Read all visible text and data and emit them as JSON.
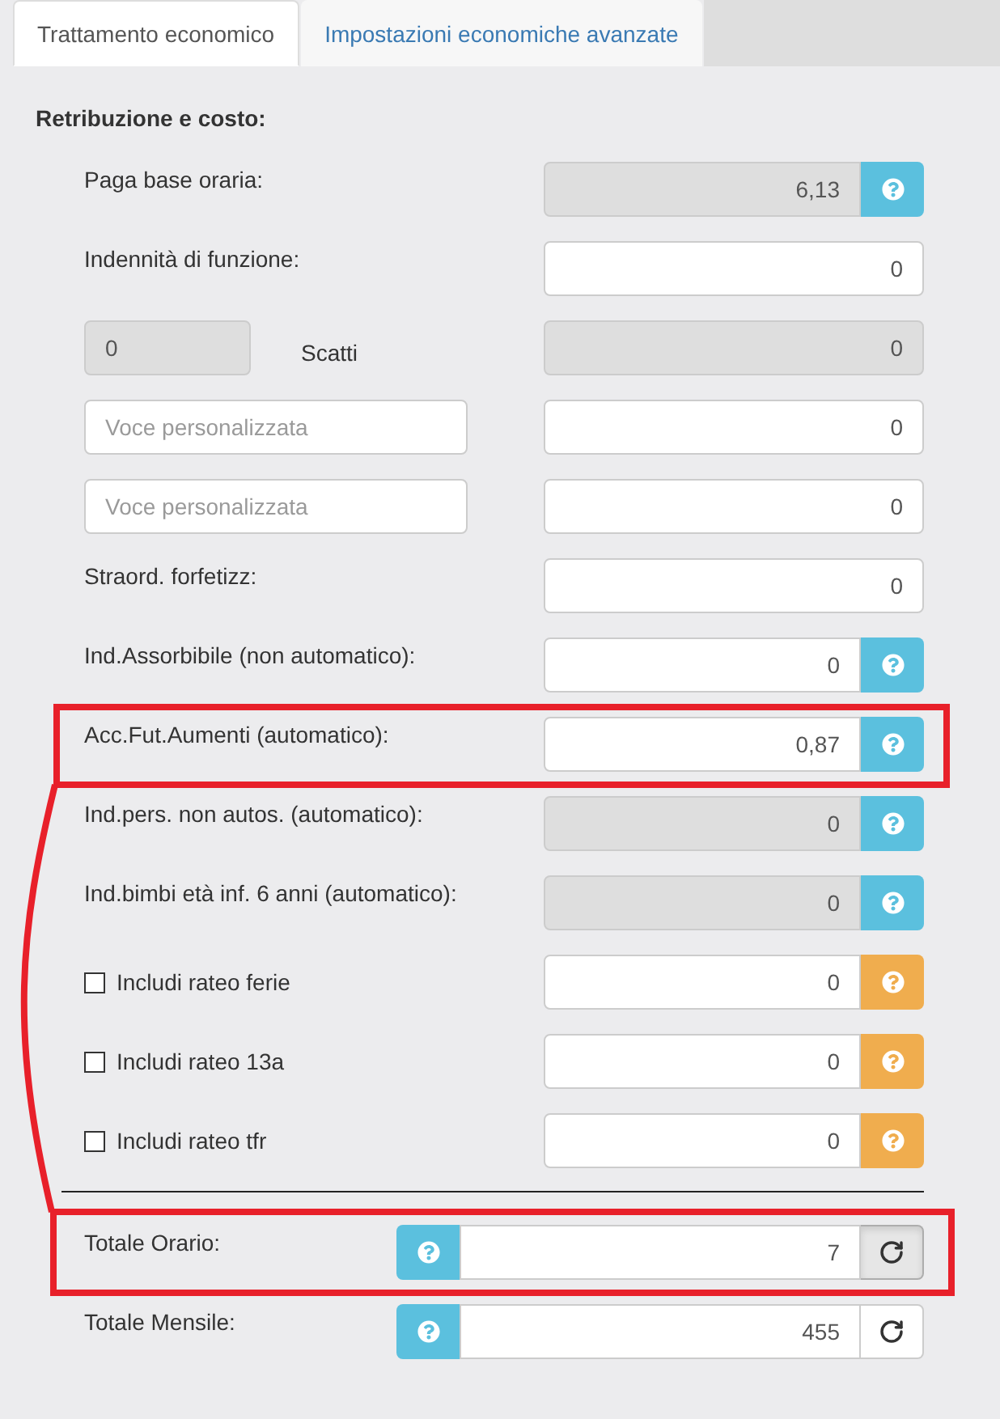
{
  "tabs": [
    {
      "label": "Trattamento economico",
      "selected": true
    },
    {
      "label": "Impostazioni economiche avanzate",
      "selected": false
    }
  ],
  "section_title": "Retribuzione e costo:",
  "rows": [
    {
      "kind": "label",
      "label": "Paga base oraria:",
      "value": "6,13",
      "disabled": true,
      "help_button": {
        "color": "#5bc0de"
      },
      "highlighted": false
    },
    {
      "kind": "label",
      "label": "Indennità di funzione:",
      "value": "0",
      "disabled": false,
      "highlighted": false
    },
    {
      "kind": "steps",
      "count": "0",
      "count_disabled": true,
      "label": "Scatti",
      "value": "0",
      "disabled": true,
      "highlighted": false
    },
    {
      "kind": "custom",
      "placeholder": "Voce personalizzata",
      "value": "0",
      "disabled": false,
      "highlighted": false
    },
    {
      "kind": "custom",
      "placeholder": "Voce personalizzata",
      "value": "0",
      "disabled": false,
      "highlighted": false
    },
    {
      "kind": "label",
      "label": "Straord. forfetizz:",
      "value": "0",
      "disabled": false,
      "highlighted": false
    },
    {
      "kind": "label",
      "label": "Ind.Assorbibile (non automatico):",
      "value": "0",
      "disabled": false,
      "help_button": {
        "color": "#5bc0de"
      },
      "highlighted": false
    },
    {
      "kind": "label",
      "label": "Acc.Fut.Aumenti (automatico):",
      "value": "0,87",
      "disabled": false,
      "help_button": {
        "color": "#5bc0de"
      },
      "highlighted": true
    },
    {
      "kind": "label",
      "label": "Ind.pers. non autos. (automatico):",
      "value": "0",
      "disabled": true,
      "help_button": {
        "color": "#5bc0de"
      },
      "highlighted": false
    },
    {
      "kind": "label",
      "label": "Ind.bimbi età inf. 6 anni (automatico):",
      "value": "0",
      "disabled": true,
      "help_button": {
        "color": "#5bc0de"
      },
      "highlighted": false
    },
    {
      "kind": "checkbox",
      "label": "Includi rateo ferie",
      "checked": false,
      "value": "0",
      "disabled": false,
      "help_button": {
        "color": "#f0ad4e"
      },
      "highlighted": false
    },
    {
      "kind": "checkbox",
      "label": "Includi rateo 13a",
      "checked": false,
      "value": "0",
      "disabled": false,
      "help_button": {
        "color": "#f0ad4e"
      },
      "highlighted": false
    },
    {
      "kind": "checkbox",
      "label": "Includi rateo tfr",
      "checked": false,
      "value": "0",
      "disabled": false,
      "help_button": {
        "color": "#f0ad4e"
      },
      "highlighted": false
    }
  ],
  "totals": [
    {
      "label": "Totale Orario:",
      "value": "7",
      "help_button": {
        "color": "#5bc0de"
      },
      "refresh_pressed": true,
      "highlighted": true
    },
    {
      "label": "Totale Mensile:",
      "value": "455",
      "help_button": {
        "color": "#5bc0de"
      },
      "refresh_pressed": false,
      "highlighted": false
    }
  ],
  "highlight_connector": true
}
